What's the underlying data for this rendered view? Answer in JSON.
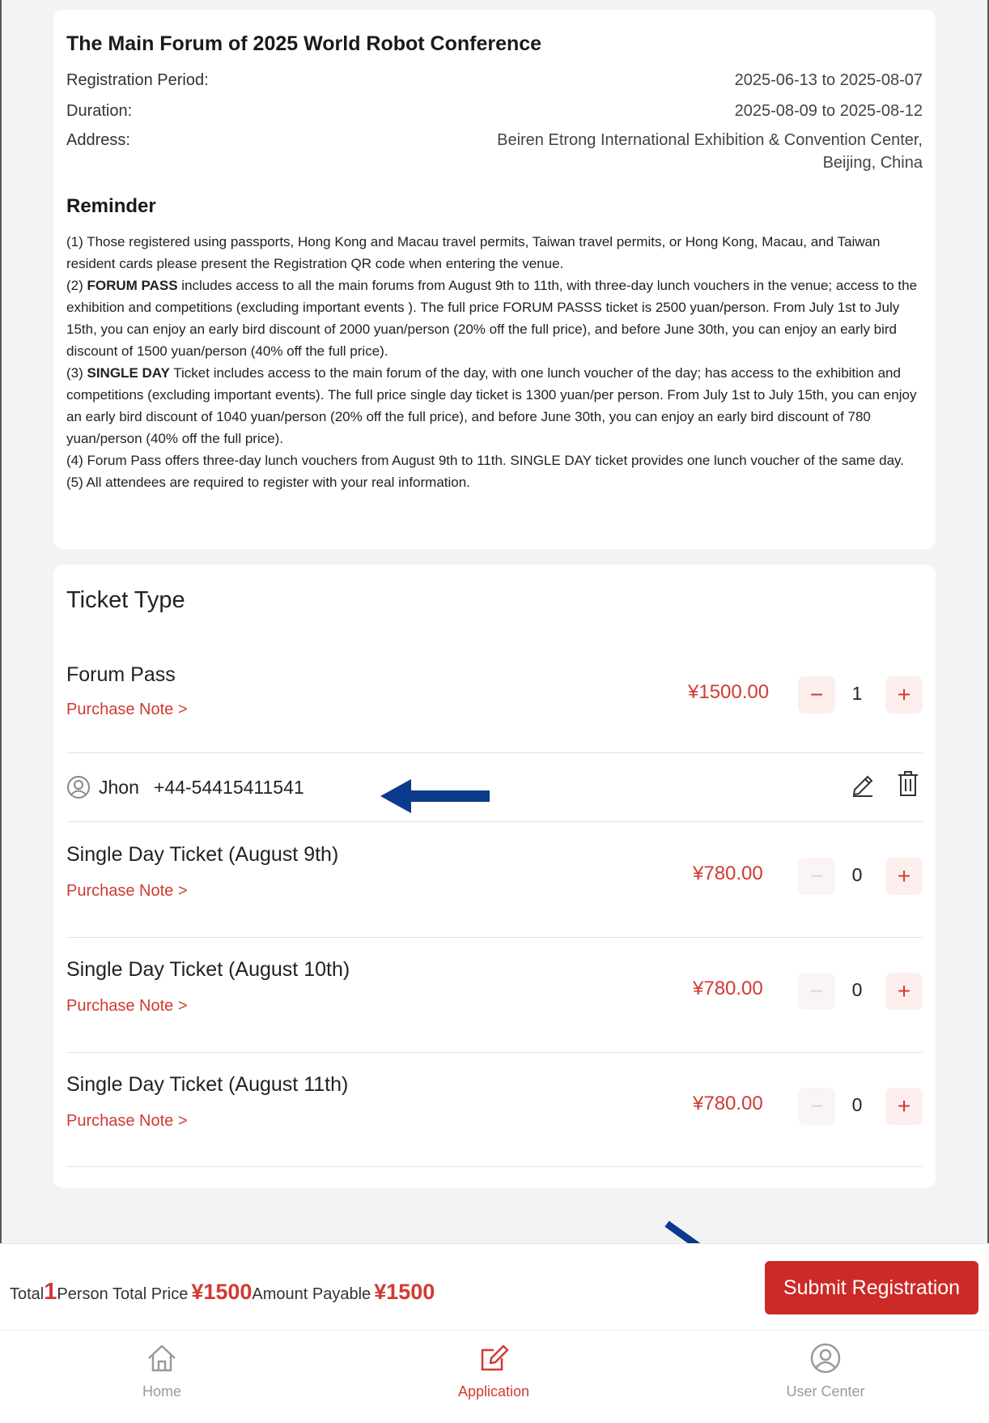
{
  "event": {
    "title": "The Main Forum of 2025 World Robot Conference",
    "registration_label": "Registration Period:",
    "registration_value": "2025-06-13 to 2025-08-07",
    "duration_label": "Duration:",
    "duration_value": "2025-08-09 to 2025-08-12",
    "address_label": "Address:",
    "address_line1": "Beiren Etrong International Exhibition & Convention Center,",
    "address_line2": "Beijing, China"
  },
  "reminder": {
    "title": "Reminder",
    "p1": "(1) Those registered using passports, Hong Kong and Macau travel permits, Taiwan travel permits, or Hong Kong, Macau, and Taiwan resident cards please present the Registration QR code when entering the venue.",
    "p2_prefix": "(2) ",
    "p2_bold": "FORUM PASS",
    "p2_rest": " includes access to all the main forums from August 9th to 11th, with three-day lunch vouchers in the venue; access to the exhibition and competitions (excluding important events ). The full price FORUM PASSS ticket is 2500 yuan/person. From July 1st to July 15th, you can enjoy an early bird discount of 2000 yuan/person (20% off the full price), and before June 30th, you can enjoy an early bird discount of 1500 yuan/person (40% off the full price).",
    "p3_prefix": "(3) ",
    "p3_bold": "SINGLE DAY",
    "p3_rest": " Ticket includes access to the main forum of the day, with one lunch voucher of the day; has access to the exhibition and  competitions (excluding important events). The full price single day ticket is 1300 yuan/per person. From July 1st to July 15th, you can enjoy an early bird discount of 1040 yuan/person (20% off the full price), and before June 30th, you can enjoy an early bird discount of 780 yuan/person (40% off the full price).",
    "p4": "(4) Forum Pass offers three-day lunch vouchers from August 9th to 11th. SINGLE DAY ticket provides one lunch voucher of the same day.",
    "p5": "(5) All attendees are required to register with your real information."
  },
  "tickets": {
    "heading": "Ticket Type",
    "minus": "−",
    "plus": "+",
    "items": [
      {
        "name": "Forum Pass",
        "note": "Purchase Note >",
        "price": "¥1500.00",
        "qty": "1"
      },
      {
        "name": "Single Day Ticket (August 9th)",
        "note": "Purchase Note >",
        "price": "¥780.00",
        "qty": "0"
      },
      {
        "name": "Single Day Ticket (August 10th)",
        "note": "Purchase Note >",
        "price": "¥780.00",
        "qty": "0"
      },
      {
        "name": "Single Day Ticket (August 11th)",
        "note": "Purchase Note >",
        "price": "¥780.00",
        "qty": "0"
      }
    ],
    "attendee": {
      "name": "Jhon",
      "phone": "+44-54415411541"
    }
  },
  "summary": {
    "total_label": "Total",
    "person_count": "1",
    "person_total_label": "Person Total Price",
    "person_total": "¥1500",
    "payable_label": "Amount Payable",
    "payable": "¥1500",
    "submit_label": "Submit Registration"
  },
  "tabbar": {
    "home": "Home",
    "application": "Application",
    "user_center": "User Center"
  },
  "colors": {
    "accent": "#d13a33",
    "submit": "#cc2a27",
    "arrow": "#0b3a8c"
  }
}
